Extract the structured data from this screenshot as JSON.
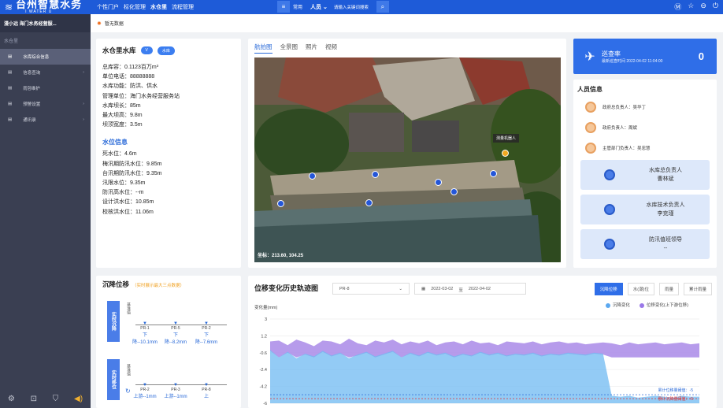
{
  "app": {
    "name_cn": "台州智慧水务",
    "name_en": "I WATER U"
  },
  "nav": [
    "个性门户",
    "标化管理",
    "水仓里",
    "流程管理"
  ],
  "nav_active": "水仓里",
  "toolbar": {
    "common": "常用",
    "person": "人员",
    "search_placeholder": "请输入关键词搜索"
  },
  "top_right_icons": [
    "menu-icon",
    "star-icon",
    "minus-circle-icon",
    "power-icon"
  ],
  "org": "漫小远 海门水务经营服...",
  "notice": "暂无数据",
  "sidebar": {
    "group": "水仓里",
    "items": [
      {
        "label": "水库综合信息",
        "active": true,
        "arrow": false
      },
      {
        "label": "信息查询",
        "active": false,
        "arrow": true
      },
      {
        "label": "雨험维护",
        "active": false,
        "arrow": false
      },
      {
        "label": "预警设置",
        "active": false,
        "arrow": true
      },
      {
        "label": "通讯录",
        "active": false,
        "arrow": true
      }
    ]
  },
  "reservoir": {
    "name": "水仓里水库",
    "badge1": "V",
    "badge2": "水库",
    "rows": [
      "总库容：0.1123百万m³",
      "单位电话：88888888",
      "水库功能：防洪、供水",
      "管理单位：海门水务经营服务站",
      "水库坝长：85m",
      "最大坝高：9.8m",
      "坝顶宽度：3.5m"
    ],
    "water_title": "水位信息",
    "water_rows": [
      "死水位：4.6m",
      "梅汛期防汛水位：9.85m",
      "台汛期防汛水位：9.35m",
      "汛限水位：9.35m",
      "防汛高水位：--m",
      "设计洪水位：10.85m",
      "校核洪水位：11.06m"
    ]
  },
  "photo": {
    "tabs": [
      "航拍图",
      "全景图",
      "照片",
      "视频"
    ],
    "active_tab": "航拍图",
    "coord": "坐标：213.60, 104.25",
    "tag": "测量机器人"
  },
  "patrol": {
    "title": "巡查率",
    "time": "最新巡查时间 2022-04-02 11:04:00",
    "value": "0"
  },
  "people": {
    "title": "人员信息",
    "list": [
      "政府总负责人：吴华丁",
      "政府负责人：周斌",
      "主管部门负责人：吴忠慧"
    ],
    "cards": [
      {
        "role": "水库总负责人",
        "name": "曹林斌"
      },
      {
        "role": "水库技术负责人",
        "name": "李克瑾"
      },
      {
        "role": "防汛值班领导",
        "name": "--"
      }
    ]
  },
  "settlement": {
    "title": "沉降位移",
    "hint": "（实时展示最大三点数据）",
    "block1": "实时沉降",
    "block2": "实时移位",
    "base_label": "基准值",
    "group1": [
      {
        "id": "PR-1",
        "dir": "下",
        "value": "降--10.1mm"
      },
      {
        "id": "PR-5",
        "dir": "下",
        "value": "降--8.2mm"
      },
      {
        "id": "PR-2",
        "dir": "下",
        "value": "降--7.6mm"
      }
    ],
    "group2": [
      {
        "id": "PR-2",
        "value": "上游--1mm"
      },
      {
        "id": "PR-3",
        "value": "上游--1mm"
      },
      {
        "id": "PR-8",
        "value": "上"
      }
    ]
  },
  "track": {
    "title": "位移变化历史轨迹图",
    "select": "PR-8",
    "date_from": "2022-03-02",
    "date_sep": "至",
    "date_to": "2022-04-02",
    "buttons": [
      "沉降位移",
      "水(潮)位",
      "雨量",
      "累计雨量"
    ],
    "active_button": "沉降位移",
    "legend": [
      {
        "name": "沉降变化",
        "color": "#5ba8f0"
      },
      {
        "name": "位移变化(上下游位移)",
        "color": "#9a78e8"
      }
    ],
    "ylabel": "变化量(mm)",
    "threshold_labels": [
      "累计位移量阈值：-5",
      "累计沉降量阈值：-5"
    ]
  },
  "chart_data": {
    "type": "area",
    "ylabel": "变化量(mm)",
    "ylim": [
      -6,
      3
    ],
    "yticks": [
      3,
      1.2,
      -0.6,
      -2.4,
      -4.2,
      -6
    ],
    "series": [
      {
        "name": "沉降变化",
        "values": [
          -0.3,
          -1.1,
          -0.5,
          -1.2,
          -0.7,
          -1.0,
          -0.4,
          -0.9,
          -0.6,
          -1.2,
          -0.8,
          -0.5,
          -1.0,
          -0.7,
          -0.4,
          -1.1,
          -0.6,
          -0.9,
          -0.5,
          -0.8,
          -0.6,
          -1.0,
          -0.7,
          -0.9,
          -0.5,
          -0.8,
          -0.6,
          -0.9,
          -0.7,
          -0.8,
          -0.6,
          -0.9,
          -0.7,
          -0.8,
          -0.6,
          -0.7,
          -0.8,
          -0.6,
          -0.7,
          -5.2,
          -5.3,
          -5.2,
          -5.4,
          -5.3,
          -5.2,
          -5.3,
          -5.4,
          -5.2,
          -5.3,
          -5.3
        ]
      },
      {
        "name": "位移变化(上下游位移)",
        "values": [
          0.2,
          0.3,
          -0.2,
          0.4,
          0.1,
          -0.3,
          0.3,
          0.2,
          -0.1,
          0.5,
          0.0,
          -0.2,
          0.3,
          0.1,
          0.4,
          -0.1,
          0.2,
          0.0,
          0.3,
          -0.2,
          0.1,
          0.2,
          -0.1,
          0.3,
          0.0,
          0.1,
          -0.2,
          0.2,
          0.1,
          0.0,
          0.2,
          -0.1,
          0.1,
          0.2,
          0.0,
          0.1,
          -0.1,
          0.0,
          0.1,
          0.0,
          -0.2,
          0.1,
          -0.1,
          0.0,
          0.1,
          -0.1,
          0.0,
          0.1,
          -0.1,
          0.0
        ]
      }
    ],
    "thresholds": [
      -5,
      -5
    ]
  }
}
